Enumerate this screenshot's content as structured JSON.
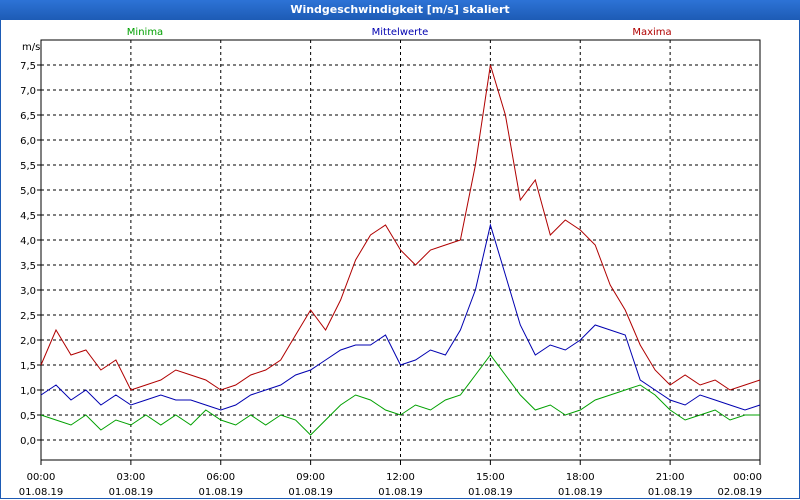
{
  "window": {
    "title": "Windgeschwindigkeit [m/s] skaliert"
  },
  "chart_data": {
    "type": "line",
    "title": "Windgeschwindigkeit [m/s] skaliert",
    "ylabel": "m/s",
    "ylim": [
      -0.4,
      8.0
    ],
    "yticks": [
      0.0,
      0.5,
      1.0,
      1.5,
      2.0,
      2.5,
      3.0,
      3.5,
      4.0,
      4.5,
      5.0,
      5.5,
      6.0,
      6.5,
      7.0,
      7.5
    ],
    "ytick_labels": [
      "0,0",
      "0,5",
      "1,0",
      "1,5",
      "2,0",
      "2,5",
      "3,0",
      "3,5",
      "4,0",
      "4,5",
      "5,0",
      "5,5",
      "6,0",
      "6,5",
      "7,0",
      "7,5"
    ],
    "xlim": [
      0,
      24
    ],
    "xticks": [
      0,
      3,
      6,
      9,
      12,
      15,
      18,
      21,
      24
    ],
    "xtick_labels": [
      [
        "00:00",
        "01.08.19"
      ],
      [
        "03:00",
        "01.08.19"
      ],
      [
        "06:00",
        "01.08.19"
      ],
      [
        "09:00",
        "01.08.19"
      ],
      [
        "12:00",
        "01.08.19"
      ],
      [
        "15:00",
        "01.08.19"
      ],
      [
        "18:00",
        "01.08.19"
      ],
      [
        "21:00",
        "01.08.19"
      ],
      [
        "00:00",
        "02.08.19"
      ]
    ],
    "grid": true,
    "legend_position": "top",
    "series": [
      {
        "name": "Minima",
        "color": "#00a000",
        "x": [
          0,
          0.5,
          1,
          1.5,
          2,
          2.5,
          3,
          3.5,
          4,
          4.5,
          5,
          5.5,
          6,
          6.5,
          7,
          7.5,
          8,
          8.5,
          9,
          9.5,
          10,
          10.5,
          11,
          11.5,
          12,
          12.5,
          13,
          13.5,
          14,
          14.5,
          15,
          15.5,
          16,
          16.5,
          17,
          17.5,
          18,
          18.5,
          19,
          19.5,
          20,
          20.5,
          21,
          21.5,
          22,
          22.5,
          23,
          23.5,
          24
        ],
        "values": [
          0.5,
          0.4,
          0.3,
          0.5,
          0.2,
          0.4,
          0.3,
          0.5,
          0.3,
          0.5,
          0.3,
          0.6,
          0.4,
          0.3,
          0.5,
          0.3,
          0.5,
          0.4,
          0.1,
          0.4,
          0.7,
          0.9,
          0.8,
          0.6,
          0.5,
          0.7,
          0.6,
          0.8,
          0.9,
          1.3,
          1.7,
          1.3,
          0.9,
          0.6,
          0.7,
          0.5,
          0.6,
          0.8,
          0.9,
          1.0,
          1.1,
          0.9,
          0.6,
          0.4,
          0.5,
          0.6,
          0.4,
          0.5,
          0.5
        ]
      },
      {
        "name": "Mittelwerte",
        "color": "#0000b0",
        "x": [
          0,
          0.5,
          1,
          1.5,
          2,
          2.5,
          3,
          3.5,
          4,
          4.5,
          5,
          5.5,
          6,
          6.5,
          7,
          7.5,
          8,
          8.5,
          9,
          9.5,
          10,
          10.5,
          11,
          11.5,
          12,
          12.5,
          13,
          13.5,
          14,
          14.5,
          15,
          15.5,
          16,
          16.5,
          17,
          17.5,
          18,
          18.5,
          19,
          19.5,
          20,
          20.5,
          21,
          21.5,
          22,
          22.5,
          23,
          23.5,
          24
        ],
        "values": [
          0.9,
          1.1,
          0.8,
          1.0,
          0.7,
          0.9,
          0.7,
          0.8,
          0.9,
          0.8,
          0.8,
          0.7,
          0.6,
          0.7,
          0.9,
          1.0,
          1.1,
          1.3,
          1.4,
          1.6,
          1.8,
          1.9,
          1.9,
          2.1,
          1.5,
          1.6,
          1.8,
          1.7,
          2.2,
          3.0,
          4.3,
          3.3,
          2.3,
          1.7,
          1.9,
          1.8,
          2.0,
          2.3,
          2.2,
          2.1,
          1.2,
          1.0,
          0.8,
          0.7,
          0.9,
          0.8,
          0.7,
          0.6,
          0.7
        ]
      },
      {
        "name": "Maxima",
        "color": "#b00000",
        "x": [
          0,
          0.5,
          1,
          1.5,
          2,
          2.5,
          3,
          3.5,
          4,
          4.5,
          5,
          5.5,
          6,
          6.5,
          7,
          7.5,
          8,
          8.5,
          9,
          9.5,
          10,
          10.5,
          11,
          11.5,
          12,
          12.5,
          13,
          13.5,
          14,
          14.5,
          15,
          15.5,
          16,
          16.5,
          17,
          17.5,
          18,
          18.5,
          19,
          19.5,
          20,
          20.5,
          21,
          21.5,
          22,
          22.5,
          23,
          23.5,
          24
        ],
        "values": [
          1.5,
          2.2,
          1.7,
          1.8,
          1.4,
          1.6,
          1.0,
          1.1,
          1.2,
          1.4,
          1.3,
          1.2,
          1.0,
          1.1,
          1.3,
          1.4,
          1.6,
          2.1,
          2.6,
          2.2,
          2.8,
          3.6,
          4.1,
          4.3,
          3.8,
          3.5,
          3.8,
          3.9,
          4.0,
          5.5,
          7.5,
          6.5,
          4.8,
          5.2,
          4.1,
          4.4,
          4.2,
          3.9,
          3.1,
          2.6,
          1.9,
          1.4,
          1.1,
          1.3,
          1.1,
          1.2,
          1.0,
          1.1,
          1.2
        ]
      }
    ]
  }
}
